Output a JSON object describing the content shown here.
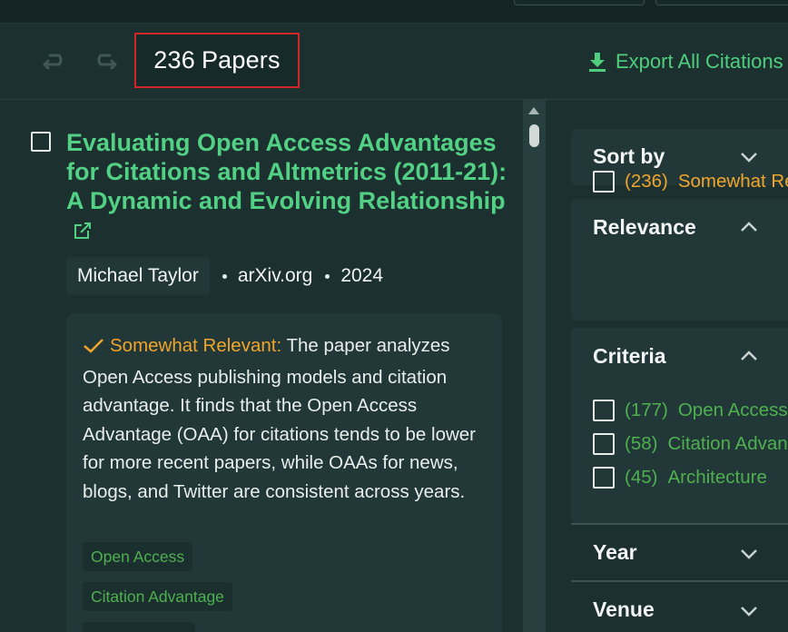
{
  "toolbar": {
    "paper_count": "236",
    "paper_count_label": "Papers",
    "export_label": "Export All Citations"
  },
  "paper": {
    "title": "Evaluating Open Access Advantages for Citations and Altmetrics (2011-21): A Dynamic and Evolving Relationship",
    "author": "Michael Taylor",
    "venue": "arXiv.org",
    "year": "2024",
    "relevance_label": "Somewhat Relevant:",
    "summary": "The paper analyzes Open Access publishing models and citation advantage. It finds that the Open Access Advantage (OAA) for citations tends to be lower for more recent papers, while OAAs for news, blogs, and Twitter are consistent across years.",
    "tags": [
      "Open Access",
      "Citation Advantage"
    ]
  },
  "filters": {
    "sort_by": "Sort by",
    "relevance": {
      "title": "Relevance",
      "items": [
        {
          "count": "(236)",
          "label": "Somewhat Relevant"
        }
      ]
    },
    "criteria": {
      "title": "Criteria",
      "items": [
        {
          "count": "(177)",
          "label": "Open Access"
        },
        {
          "count": "(58)",
          "label": "Citation Advantage"
        },
        {
          "count": "(45)",
          "label": "Architecture"
        }
      ]
    },
    "year": "Year",
    "venue": "Venue"
  },
  "colors": {
    "background": "#1c3030",
    "accent_green": "#52d184",
    "relevance_orange": "#f0a52b",
    "tag_green": "#4fb04f",
    "highlight_border": "#d0262a"
  }
}
